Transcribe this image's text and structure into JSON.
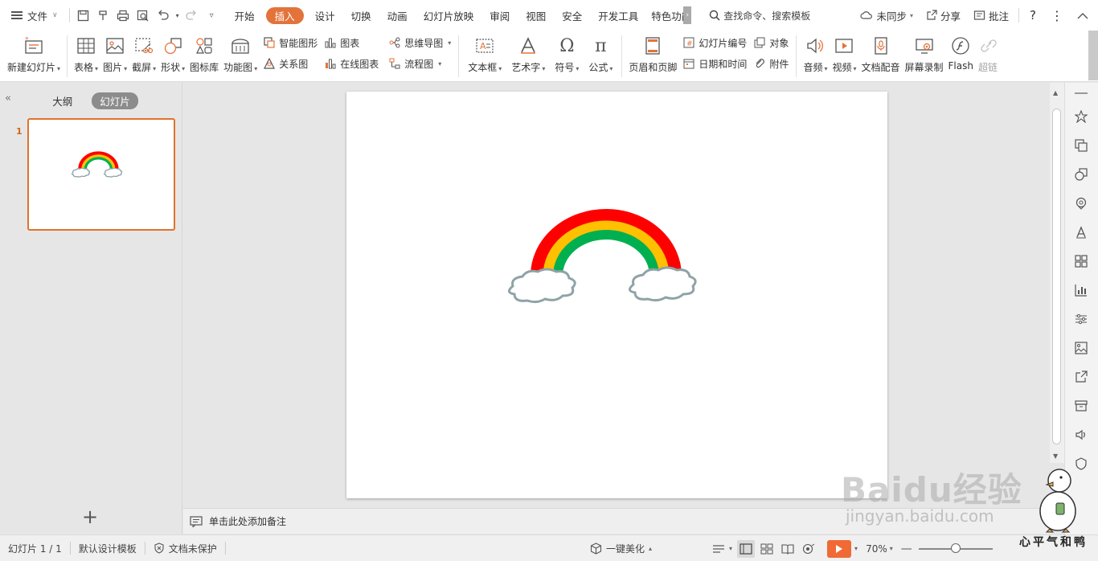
{
  "menu": {
    "file": "文件",
    "tabs": [
      "开始",
      "插入",
      "设计",
      "切换",
      "动画",
      "幻灯片放映",
      "审阅",
      "视图",
      "安全",
      "开发工具",
      "特色功能"
    ],
    "active_tab": "插入",
    "search": "查找命令、搜索模板",
    "sync": "未同步",
    "share": "分享",
    "comment": "批注",
    "help": "?"
  },
  "ribbon": {
    "new_slide": "新建幻灯片",
    "table": "表格",
    "picture": "图片",
    "screenshot": "截屏",
    "shape": "形状",
    "icon_lib": "图标库",
    "func_chart": "功能图",
    "smart_art": "智能图形",
    "chart": "图表",
    "relation": "关系图",
    "online_chart": "在线图表",
    "mind_map": "思维导图",
    "flowchart": "流程图",
    "textbox": "文本框",
    "wordart": "艺术字",
    "symbol": "符号",
    "formula": "公式",
    "header_footer": "页眉和页脚",
    "slide_number": "幻灯片编号",
    "object": "对象",
    "date_time": "日期和时间",
    "attachment": "附件",
    "audio": "音频",
    "video": "视频",
    "doc_voice": "文档配音",
    "screen_record": "屏幕录制",
    "flash": "Flash",
    "hyperlink": "超链"
  },
  "leftpane": {
    "tab_outline": "大纲",
    "tab_slides": "幻灯片",
    "slide_number": "1"
  },
  "notes": {
    "placeholder": "单击此处添加备注"
  },
  "statusbar": {
    "slide_pos": "幻灯片 1 / 1",
    "template": "默认设计模板",
    "protect": "文档未保护",
    "beautify": "一键美化",
    "zoom": "70%"
  },
  "watermark": {
    "brand": "Baidu经验",
    "url": "jingyan.baidu.com",
    "slogan": "心平气和鸭"
  },
  "colors": {
    "accent": "#e3733a",
    "rainbow_red": "#ff0000",
    "rainbow_yellow": "#ffc000",
    "rainbow_green": "#00b050",
    "cloud_outline": "#8ea3a6"
  }
}
